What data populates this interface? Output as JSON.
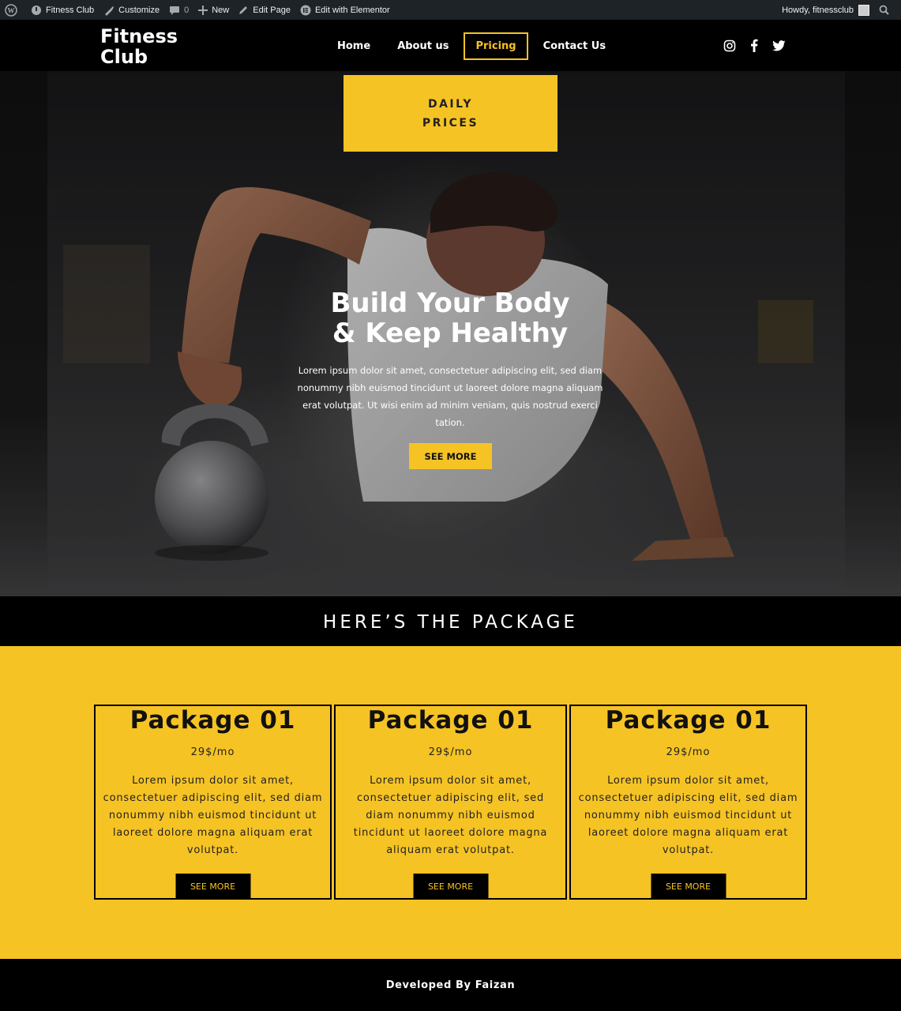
{
  "admin_bar": {
    "site_name": "Fitness Club",
    "customize": "Customize",
    "comments_count": "0",
    "new": "New",
    "edit_page": "Edit Page",
    "edit_elementor": "Edit with Elementor",
    "howdy": "Howdy, fitnessclub"
  },
  "header": {
    "logo_line1": "Fitness",
    "logo_line2": "Club",
    "nav": [
      "Home",
      "About us",
      "Pricing",
      "Contact Us"
    ],
    "active_nav": "Pricing",
    "social_icons": [
      "instagram-icon",
      "facebook-icon",
      "twitter-icon"
    ]
  },
  "hero": {
    "badge_line1": "DAILY",
    "badge_line2": "PRICES",
    "title_line1": "Build Your Body",
    "title_line2": "& Keep Healthy",
    "text": "Lorem ipsum dolor sit amet, consectetuer adipiscing elit, sed diam nonummy nibh euismod tincidunt ut laoreet dolore magna aliquam erat volutpat. Ut wisi enim ad minim veniam, quis nostrud exerci tation.",
    "button": "SEE MORE"
  },
  "packages": {
    "heading": "HERE’S THE PACKAGE",
    "cards": [
      {
        "title": "Package 01",
        "price": "29$/mo",
        "text": "Lorem ipsum dolor sit amet, consectetuer adipiscing elit, sed diam nonummy nibh euismod tincidunt ut laoreet dolore magna aliquam erat volutpat.",
        "button": "SEE MORE"
      },
      {
        "title": "Package 01",
        "price": "29$/mo",
        "text": "Lorem ipsum dolor sit amet, consectetuer adipiscing elit, sed diam nonummy nibh euismod tincidunt ut laoreet dolore magna aliquam erat volutpat.",
        "button": "SEE MORE"
      },
      {
        "title": "Package 01",
        "price": "29$/mo",
        "text": "Lorem ipsum dolor sit amet, consectetuer adipiscing elit, sed diam nonummy nibh euismod tincidunt ut laoreet dolore magna aliquam erat volutpat.",
        "button": "SEE MORE"
      }
    ]
  },
  "footer": {
    "text": "Developed By Faizan"
  },
  "colors": {
    "accent": "#f6c324",
    "dark": "#000000",
    "admin_bar": "#1d2327"
  }
}
